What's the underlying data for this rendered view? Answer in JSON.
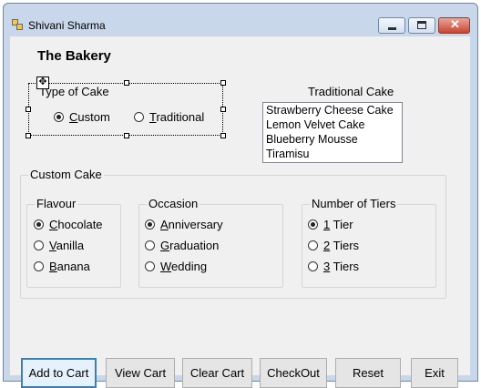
{
  "window": {
    "title": "Shivani Sharma"
  },
  "heading": "The Bakery",
  "type_of_cake": {
    "label": "Type of Cake",
    "options": [
      {
        "label": "Custom",
        "checked": true
      },
      {
        "label": "Traditional",
        "checked": false
      }
    ]
  },
  "traditional_cake": {
    "label": "Traditional Cake",
    "items": [
      "Strawberry Cheese Cake",
      "Lemon Velvet Cake",
      "Blueberry Mousse",
      "Tiramisu"
    ]
  },
  "custom_cake": {
    "label": "Custom Cake",
    "flavour": {
      "label": "Flavour",
      "options": [
        {
          "label": "Chocolate",
          "checked": true
        },
        {
          "label": "Vanilla",
          "checked": false
        },
        {
          "label": "Banana",
          "checked": false
        }
      ]
    },
    "occasion": {
      "label": "Occasion",
      "options": [
        {
          "label": "Anniversary",
          "checked": true
        },
        {
          "label": "Graduation",
          "checked": false
        },
        {
          "label": "Wedding",
          "checked": false
        }
      ]
    },
    "tiers": {
      "label": "Number of Tiers",
      "options": [
        {
          "label": "1 Tier",
          "checked": true
        },
        {
          "label": "2 Tiers",
          "checked": false
        },
        {
          "label": "3 Tiers",
          "checked": false
        }
      ]
    }
  },
  "buttons": {
    "add_to_cart": "Add to Cart",
    "view_cart": "View Cart",
    "clear_cart": "Clear Cart",
    "checkout": "CheckOut",
    "reset": "Reset",
    "exit": "Exit"
  },
  "icons": {
    "app": "app-form-icon",
    "minimize": "minimize-icon",
    "maximize": "maximize-icon",
    "close": "close-icon",
    "move": "move-handle-icon"
  }
}
